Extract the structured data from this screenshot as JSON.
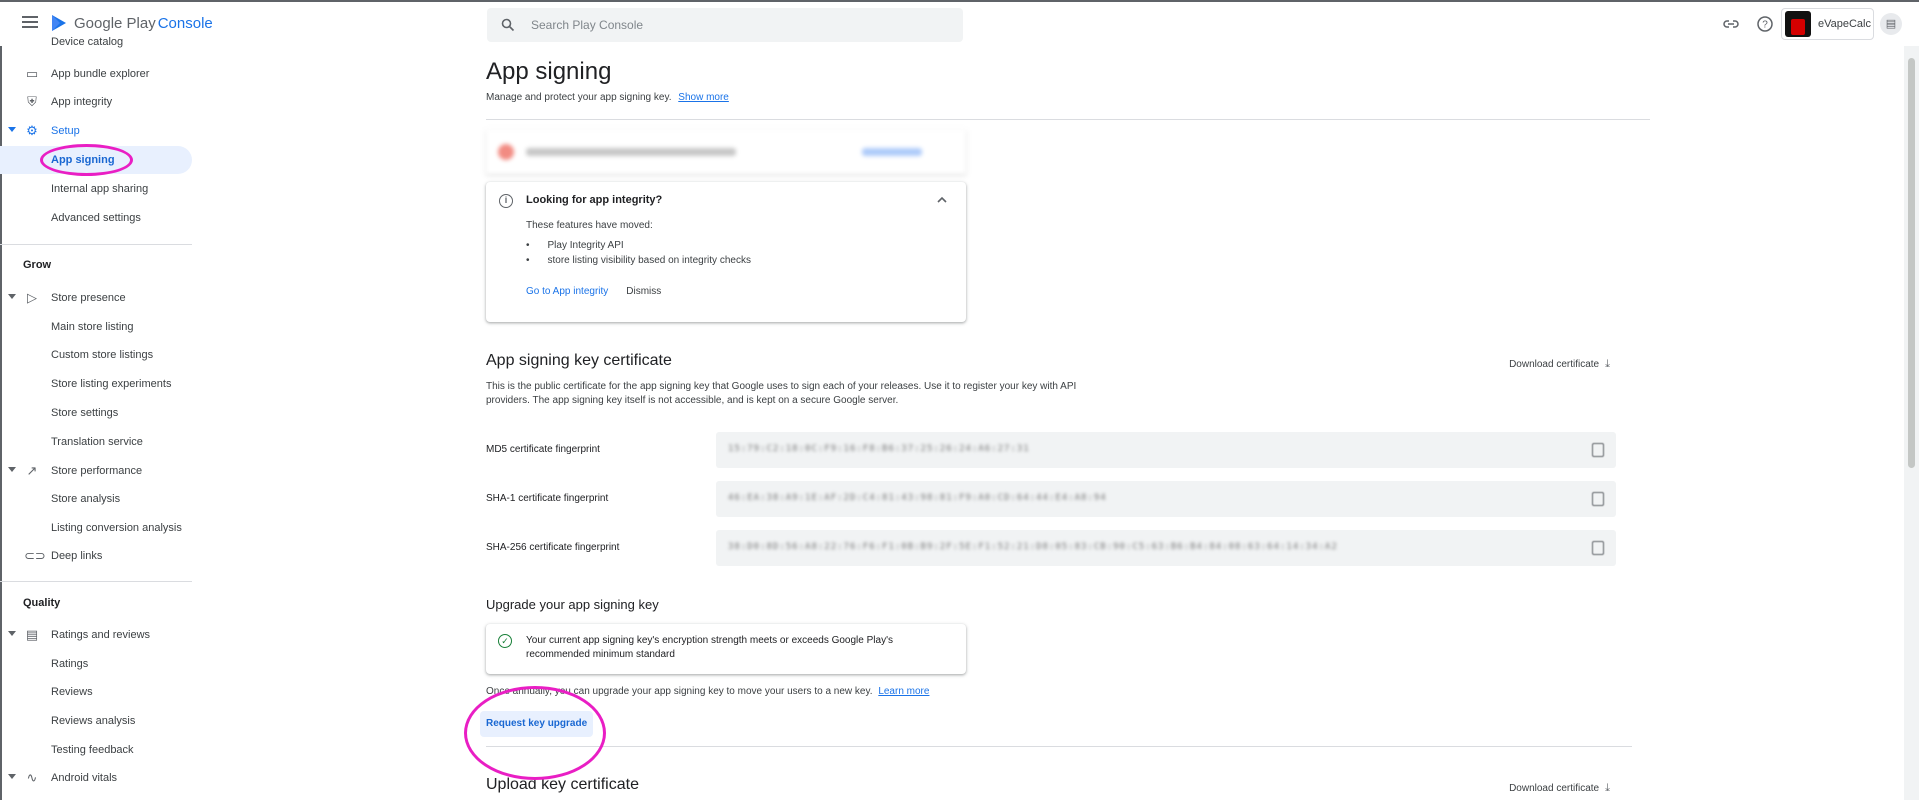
{
  "app": {
    "logo_prefix": "Google Play",
    "logo_suffix": "Console",
    "search_placeholder": "Search Play Console",
    "account_name": "eVapeCalc"
  },
  "sidebar": {
    "top_items": [
      {
        "label": "Device catalog",
        "icon": "phone-icon"
      },
      {
        "label": "App bundle explorer",
        "icon": "bundle-icon"
      },
      {
        "label": "App integrity",
        "icon": "shield-icon"
      }
    ],
    "setup": {
      "label": "Setup",
      "icon": "gear-icon",
      "children": [
        "App signing",
        "Internal app sharing",
        "Advanced settings"
      ]
    },
    "grow_heading": "Grow",
    "store_presence": {
      "label": "Store presence",
      "icon": "play-icon",
      "children": [
        "Main store listing",
        "Custom store listings",
        "Store listing experiments",
        "Store settings",
        "Translation service"
      ]
    },
    "store_performance": {
      "label": "Store performance",
      "icon": "trending-icon",
      "children": [
        "Store analysis",
        "Listing conversion analysis"
      ]
    },
    "deep_links": {
      "label": "Deep links",
      "icon": "link-icon"
    },
    "quality_heading": "Quality",
    "ratings_reviews": {
      "label": "Ratings and reviews",
      "icon": "review-icon",
      "children": [
        "Ratings",
        "Reviews",
        "Reviews analysis",
        "Testing feedback"
      ]
    },
    "android_vitals": {
      "label": "Android vitals",
      "icon": "vitals-icon"
    }
  },
  "main": {
    "title": "App signing",
    "subtitle": "Manage and protect your app signing key.",
    "show_more": "Show more",
    "integrity_card": {
      "title": "Looking for app integrity?",
      "text": "These features have moved:",
      "bullets": [
        "Play Integrity API",
        "store listing visibility based on integrity checks"
      ],
      "primary_action": "Go to App integrity",
      "secondary_action": "Dismiss"
    },
    "signing_cert": {
      "title": "App signing key certificate",
      "download": "Download certificate",
      "description": "This is the public certificate for the app signing key that Google uses to sign each of your releases. Use it to register your key with API providers. The app signing key itself is not accessible, and is kept on a secure Google server.",
      "fingerprints": [
        {
          "label": "MD5 certificate fingerprint",
          "value": "15:79:C2:18:0C:F9:16:F8:B6:37:25:26:24:A6:27:31"
        },
        {
          "label": "SHA-1 certificate fingerprint",
          "value": "46:EA:38:A9:1E:AF:2D:C4:81:43:98:81:F9:A0:CD:64:44:E4:A8:94"
        },
        {
          "label": "SHA-256 certificate fingerprint",
          "value": "38:D0:8D:56:A8:22:76:F6:F1:0B:B9:2F:5E:F1:52:21:D8:05:83:CB:90:C5:63:B6:B4:84:08:63:64:14:34:A2"
        }
      ]
    },
    "upgrade": {
      "title": "Upgrade your app signing key",
      "status": "Your current app signing key's encryption strength meets or exceeds Google Play's recommended minimum standard",
      "annual_text": "Once annually, you can upgrade your app signing key to move your users to a new key.",
      "learn_more": "Learn more",
      "button": "Request key upgrade"
    },
    "upload_cert": {
      "title": "Upload key certificate",
      "download": "Download certificate"
    }
  },
  "colors": {
    "accent": "#1a73e8",
    "annotation": "#e91ec4",
    "active_bg": "#e8f0fe"
  }
}
